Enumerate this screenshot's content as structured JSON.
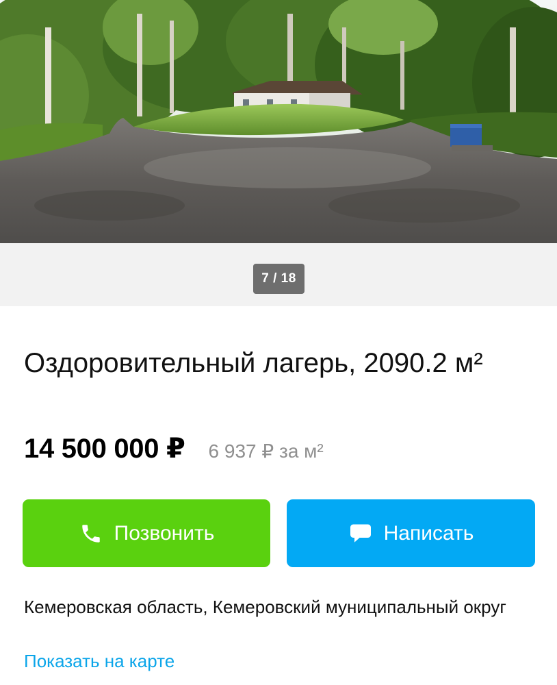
{
  "gallery": {
    "counter": "7 / 18",
    "photo_description": "photo"
  },
  "listing": {
    "title": "Оздоровительный лагерь, 2090.2 м²",
    "price": "14 500 000 ₽",
    "price_per_sqm": "6 937 ₽ за м²"
  },
  "actions": {
    "call_label": "Позвонить",
    "write_label": "Написать",
    "call_icon": "phone-icon",
    "write_icon": "chat-bubble-icon"
  },
  "location": {
    "address": "Кемеровская область, Кемеровский муниципальный округ",
    "map_link": "Показать на карте"
  },
  "colors": {
    "call_button": "#5ad10f",
    "write_button": "#03a9f4",
    "link": "#0ba5e9",
    "muted_text": "#8f8f8f"
  }
}
